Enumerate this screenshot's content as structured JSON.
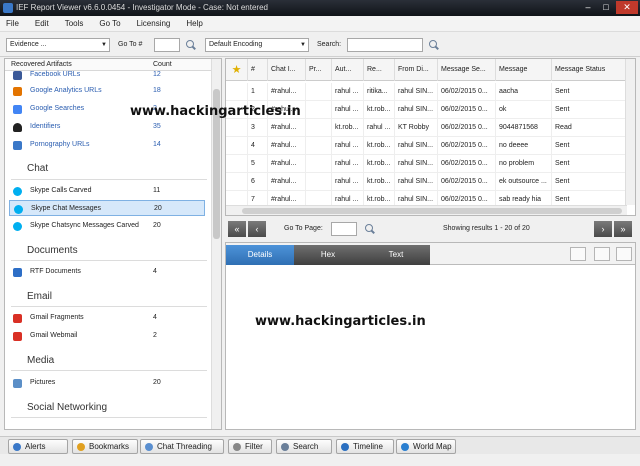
{
  "window": {
    "title": "IEF Report Viewer v6.6.0.0454 - Investigator Mode - Case: Not entered"
  },
  "menu": [
    "File",
    "Edit",
    "Tools",
    "Go To",
    "Licensing",
    "Help"
  ],
  "toolbar": {
    "evidence_value": "Evidence ...",
    "goto_label": "Go To #",
    "encoding_value": "Default Encoding",
    "search_label": "Search:"
  },
  "left_panel": {
    "header": {
      "artifacts": "Recovered Artifacts",
      "count": "Count"
    },
    "items": [
      {
        "name": "Facebook URLs",
        "count": "12",
        "link": true,
        "icon_color": "#3b5998"
      },
      {
        "name": "Google Analytics URLs",
        "count": "18",
        "link": true,
        "icon_color": "#e37400"
      },
      {
        "name": "Google Searches",
        "count": "2",
        "link": true,
        "icon_color": "#4285f4"
      },
      {
        "name": "Identifiers",
        "count": "35",
        "link": true,
        "icon_color": "#222222"
      },
      {
        "name": "Pornography URLs",
        "count": "14",
        "link": true,
        "icon_color": "#3a78c8"
      }
    ],
    "cat_chat": "Chat",
    "chat_items": [
      {
        "name": "Skype Calls Carved",
        "count": "11",
        "icon_color": "#00aff0"
      },
      {
        "name": "Skype Chat Messages",
        "count": "20",
        "icon_color": "#00aff0",
        "selected": true
      },
      {
        "name": "Skype Chatsync Messages Carved",
        "count": "20",
        "icon_color": "#00aff0"
      }
    ],
    "cat_documents": "Documents",
    "doc_items": [
      {
        "name": "RTF Documents",
        "count": "4",
        "icon_color": "#2d6ec6"
      }
    ],
    "cat_email": "Email",
    "email_items": [
      {
        "name": "Gmail Fragments",
        "count": "4",
        "icon_color": "#d93025"
      },
      {
        "name": "Gmail Webmail",
        "count": "2",
        "icon_color": "#d93025"
      }
    ],
    "cat_media": "Media",
    "media_items": [
      {
        "name": "Pictures",
        "count": "20",
        "icon_color": "#5b8fc7"
      }
    ],
    "cat_social": "Social Networking"
  },
  "grid": {
    "columns": [
      "#",
      "Chat I...",
      "Pr...",
      "Aut...",
      "Re...",
      "From Di...",
      "Message Se...",
      "Message",
      "Message Status"
    ],
    "rows": [
      [
        "1",
        "#rahul...",
        "",
        "rahul ...",
        "ritika...",
        "rahul SIN...",
        "06/02/2015 0...",
        "aacha",
        "Sent"
      ],
      [
        "2",
        "#rahul...",
        "",
        "rahul ...",
        "kt.rob...",
        "rahul SIN...",
        "06/02/2015 0...",
        "ok",
        "Sent"
      ],
      [
        "3",
        "#rahul...",
        "",
        "kt.rob...",
        "rahul ...",
        "KT Robby",
        "06/02/2015 0...",
        "9044871568",
        "Read"
      ],
      [
        "4",
        "#rahul...",
        "",
        "rahul ...",
        "kt.rob...",
        "rahul SIN...",
        "06/02/2015 0...",
        "no deeee",
        "Sent"
      ],
      [
        "5",
        "#rahul...",
        "",
        "rahul ...",
        "kt.rob...",
        "rahul SIN...",
        "06/02/2015 0...",
        "no problem",
        "Sent"
      ],
      [
        "6",
        "#rahul...",
        "",
        "rahul ...",
        "kt.rob...",
        "rahul SIN...",
        "06/02/2015 0...",
        "ek outsource ...",
        "Sent"
      ],
      [
        "7",
        "#rahul...",
        "",
        "rahul ...",
        "kt.rob...",
        "rahul SIN...",
        "06/02/2015 0...",
        "sab ready hia",
        "Sent"
      ]
    ]
  },
  "pager": {
    "goto_label": "Go To Page:",
    "results": "Showing results 1 - 20 of 20"
  },
  "details_tabs": [
    "Details",
    "Hex",
    "Text"
  ],
  "bottom_tabs": [
    {
      "label": "Alerts",
      "icon_color": "#3a78c8"
    },
    {
      "label": "Bookmarks",
      "icon_color": "#e0a020"
    },
    {
      "label": "Chat Threading",
      "icon_color": "#5a8fd0"
    },
    {
      "label": "Filter",
      "icon_color": "#888888"
    },
    {
      "label": "Search",
      "icon_color": "#6a7f99"
    },
    {
      "label": "Timeline",
      "icon_color": "#2a6fc0"
    },
    {
      "label": "World Map",
      "icon_color": "#2a7fd0"
    }
  ],
  "watermark": "www.hackingarticles.in"
}
